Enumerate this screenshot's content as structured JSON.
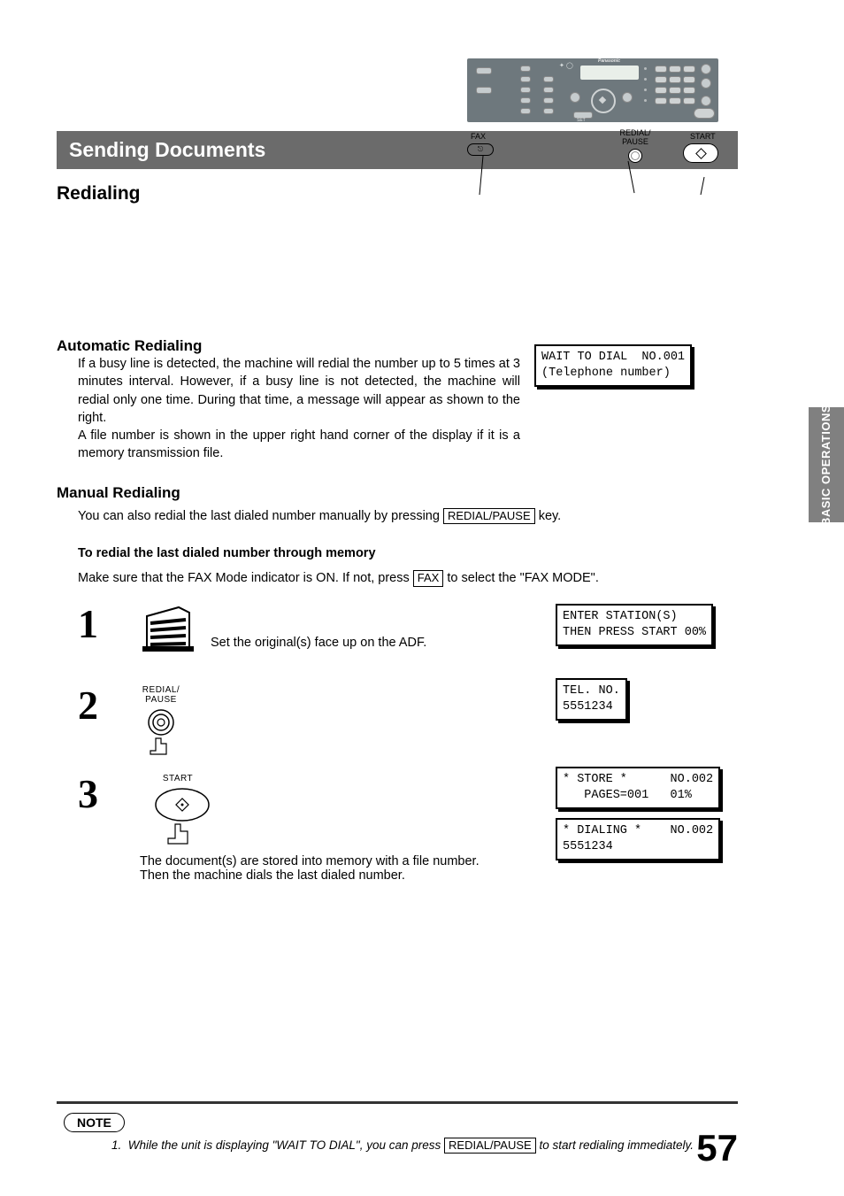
{
  "sidebar": {
    "label": "BASIC\nOPERATIONS"
  },
  "title_bar": "Sending Documents",
  "h2": "Redialing",
  "auto": {
    "heading": "Automatic Redialing",
    "para1": "If a busy line is detected, the machine will redial the number up to 5 times at 3 minutes interval.  However, if a busy line is not detected, the machine will redial only one time.  During that time, a message will appear as shown to the right.",
    "para2": "A file number is shown in the upper right hand corner of the display if it is a memory transmission file.",
    "lcd": "WAIT TO DIAL  NO.001\n(Telephone number)"
  },
  "manual": {
    "heading": "Manual Redialing",
    "intro_pre": "You can also redial the last dialed number manually by pressing ",
    "intro_key": "REDIAL/PAUSE",
    "intro_post": " key.",
    "sub": "To redial the last dialed number through memory",
    "fax_pre": "Make sure that the FAX Mode indicator is ON.  If not, press ",
    "fax_key": "FAX",
    "fax_post": " to select the \"FAX MODE\"."
  },
  "panel": {
    "brand": "Panasonic",
    "labels": {
      "fax": "FAX",
      "redial": "REDIAL/\nPAUSE",
      "start": "START"
    }
  },
  "steps": {
    "s1": {
      "num": "1",
      "text": "Set the original(s) face up on the ADF.",
      "lcd": "ENTER STATION(S)\nTHEN PRESS START 00%"
    },
    "s2": {
      "num": "2",
      "btn_label": "REDIAL/\nPAUSE",
      "lcd": "TEL. NO.\n5551234"
    },
    "s3": {
      "num": "3",
      "btn_label": "START",
      "text": "The document(s) are stored into memory with a file number.  Then the machine dials the last dialed number.",
      "lcd1": "* STORE *      NO.002\n   PAGES=001   01%",
      "lcd2": "* DIALING *    NO.002\n5551234"
    }
  },
  "note": {
    "label": "NOTE",
    "num": "1.",
    "pre": "While the unit is displaying \"WAIT TO DIAL\", you can press ",
    "key": "REDIAL/PAUSE",
    "post": " to start redialing immediately."
  },
  "page_number": "57"
}
